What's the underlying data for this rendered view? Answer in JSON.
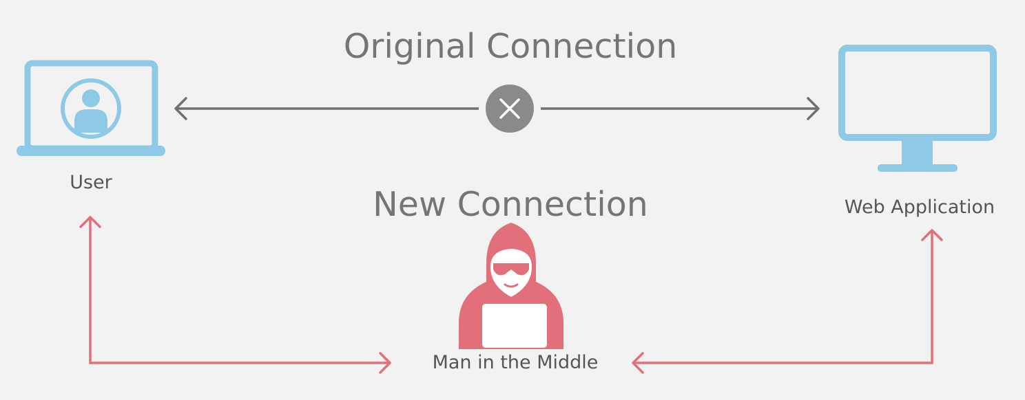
{
  "colors": {
    "background": "#f2f2f2",
    "device_blue": "#8ec9e6",
    "attacker_red": "#e1707a",
    "arrow_gray": "#707070",
    "blocked_gray": "#8a8a8a",
    "text": "#555555"
  },
  "headings": {
    "original": "Original Connection",
    "new": "New Connection"
  },
  "nodes": {
    "user": {
      "label": "User",
      "icon": "laptop-user-icon"
    },
    "web_app": {
      "label": "Web Application",
      "icon": "monitor-icon"
    },
    "mitm": {
      "label": "Man in the Middle",
      "icon": "hooded-hacker-icon"
    }
  },
  "connections": [
    {
      "from": "user",
      "to": "web_app",
      "status": "blocked",
      "icon": "x-circle-icon"
    },
    {
      "from": "user",
      "to": "mitm",
      "status": "active"
    },
    {
      "from": "mitm",
      "to": "web_app",
      "status": "active"
    }
  ]
}
